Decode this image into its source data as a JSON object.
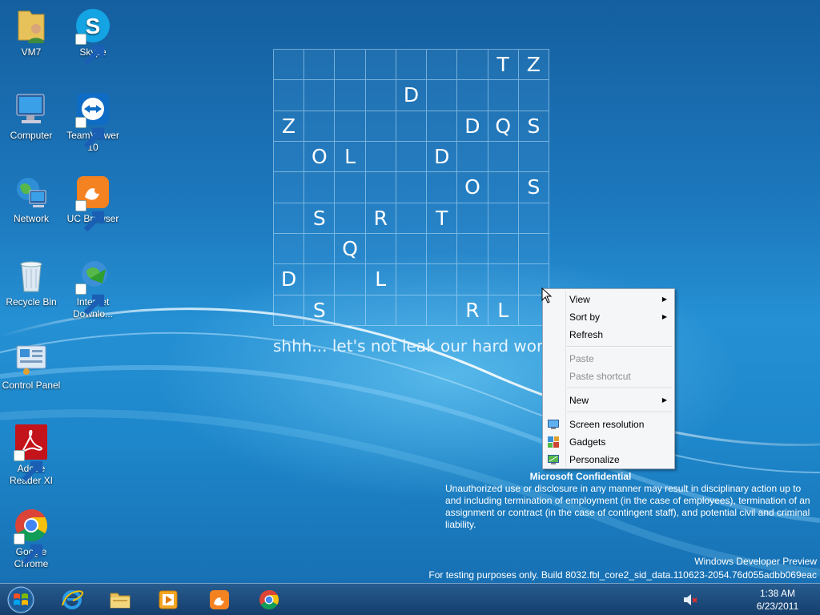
{
  "desktop_icons": [
    {
      "label": "VM7",
      "icon": "user-folder-icon",
      "shortcut": false
    },
    {
      "label": "Skype",
      "icon": "skype-icon",
      "shortcut": true
    },
    {
      "label": "Computer",
      "icon": "computer-icon",
      "shortcut": false
    },
    {
      "label": "TeamViewer 10",
      "icon": "teamviewer-icon",
      "shortcut": true
    },
    {
      "label": "Network",
      "icon": "network-icon",
      "shortcut": false
    },
    {
      "label": "UC Browser",
      "icon": "uc-browser-icon",
      "shortcut": true
    },
    {
      "label": "Recycle Bin",
      "icon": "recycle-bin-icon",
      "shortcut": false
    },
    {
      "label": "Internet Downlo...",
      "icon": "internet-download-manager-icon",
      "shortcut": true
    },
    {
      "label": "Control Panel",
      "icon": "control-panel-icon",
      "shortcut": false
    },
    {
      "label": "Adobe Reader XI",
      "icon": "adobe-reader-icon",
      "shortcut": true
    },
    {
      "label": "Google Chrome",
      "icon": "chrome-icon",
      "shortcut": true
    }
  ],
  "wallpaper": {
    "puzzle_rows": [
      [
        "",
        "",
        "",
        "",
        "",
        "",
        "",
        "T",
        "Z"
      ],
      [
        "",
        "",
        "",
        "",
        "D",
        "",
        "",
        "",
        ""
      ],
      [
        "Z",
        "",
        "",
        "",
        "",
        "",
        "D",
        "Q",
        "S"
      ],
      [
        "",
        "O",
        "L",
        "",
        "",
        "D",
        "",
        "",
        ""
      ],
      [
        "",
        "",
        "",
        "",
        "",
        "",
        "O",
        "",
        "S"
      ],
      [
        "",
        "S",
        "",
        "R",
        "",
        "T",
        "",
        "",
        ""
      ],
      [
        "",
        "",
        "Q",
        "",
        "",
        "",
        "",
        "",
        ""
      ],
      [
        "D",
        "",
        "",
        "L",
        "",
        "",
        "",
        "",
        ""
      ],
      [
        "",
        "S",
        "",
        "",
        "",
        "",
        "R",
        "L",
        ""
      ]
    ],
    "tagline": "shhh... let's not leak our hard work"
  },
  "context_menu": {
    "items": [
      {
        "label": "View",
        "submenu": true,
        "disabled": false,
        "icon": ""
      },
      {
        "label": "Sort by",
        "submenu": true,
        "disabled": false,
        "icon": ""
      },
      {
        "label": "Refresh",
        "submenu": false,
        "disabled": false,
        "icon": ""
      },
      {
        "separator": true
      },
      {
        "label": "Paste",
        "submenu": false,
        "disabled": true,
        "icon": ""
      },
      {
        "label": "Paste shortcut",
        "submenu": false,
        "disabled": true,
        "icon": ""
      },
      {
        "separator": true
      },
      {
        "label": "New",
        "submenu": true,
        "disabled": false,
        "icon": ""
      },
      {
        "separator": true
      },
      {
        "label": "Screen resolution",
        "submenu": false,
        "disabled": false,
        "icon": "screen-resolution-icon"
      },
      {
        "label": "Gadgets",
        "submenu": false,
        "disabled": false,
        "icon": "gadgets-icon"
      },
      {
        "label": "Personalize",
        "submenu": false,
        "disabled": false,
        "icon": "personalize-icon"
      }
    ]
  },
  "notice": {
    "title": "Microsoft Confidential",
    "body": "Unauthorized use or disclosure in any manner may result in disciplinary action up to and including termination of employment (in the case of employees), termination of an assignment or contract (in the case of contingent staff), and potential civil and criminal liability."
  },
  "watermark": {
    "line1": "Windows Developer Preview",
    "line2": "For testing purposes only. Build 8032.fbl_core2_sid_data.110623-2054.76d055adbb069eac"
  },
  "taskbar": {
    "pinned": [
      {
        "name": "internet-explorer",
        "icon": "internet-explorer-icon"
      },
      {
        "name": "file-explorer",
        "icon": "file-explorer-icon"
      },
      {
        "name": "media-player",
        "icon": "media-player-icon"
      },
      {
        "name": "uc-browser",
        "icon": "uc-browser-icon"
      },
      {
        "name": "chrome",
        "icon": "chrome-icon"
      }
    ],
    "tray": {
      "volume_icon": "volume-muted-icon",
      "time": "1:38 AM",
      "date": "6/23/2011"
    }
  },
  "colors": {
    "wallpaper_blue": "#1f7fc6",
    "menu_background": "#f5f6f8",
    "disabled_text": "#8d8d8d"
  }
}
